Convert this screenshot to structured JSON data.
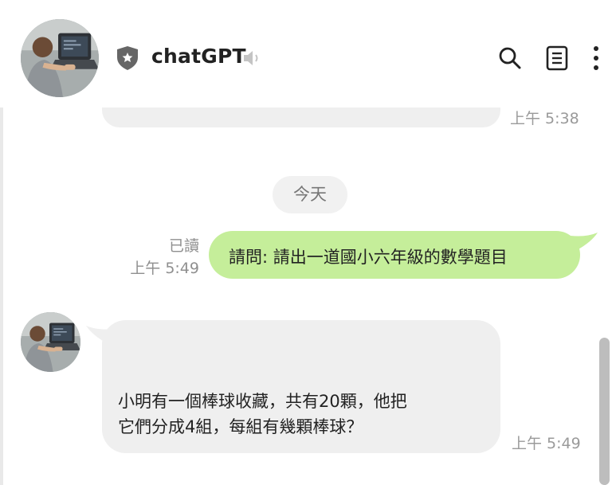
{
  "header": {
    "title": "chatGPT",
    "icons": [
      "shield-star-icon",
      "speaker-icon",
      "search-icon",
      "notes-icon",
      "more-vertical-icon"
    ]
  },
  "messages": {
    "previous": {
      "time": "上午 5:38"
    },
    "date_separator": "今天",
    "sent": {
      "read_status": "已讀",
      "time": "上午 5:49",
      "text": "請問: 請出一道國小六年級的數學題目"
    },
    "received": {
      "line1": "小明有一個棒球收藏，共有20顆，他把",
      "line2": "它們分成4組，每組有幾顆棒球？",
      "time": "上午 5:49"
    }
  },
  "colors": {
    "sent_bubble": "#c5ee9a",
    "received_bubble": "#efefef",
    "timestamp": "#9a9a9a"
  }
}
